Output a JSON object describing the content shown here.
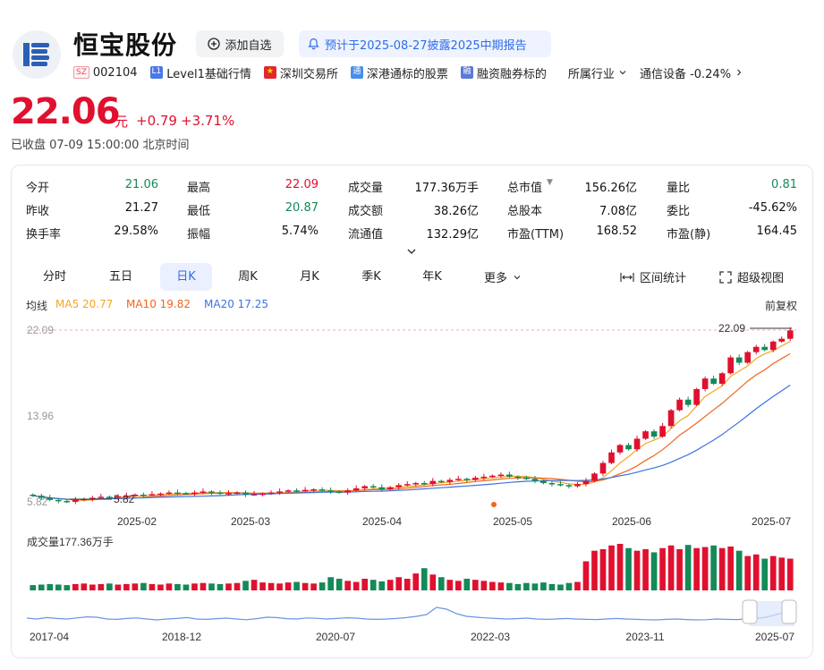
{
  "stock": {
    "name": "恒宝股份",
    "market": "SZ",
    "code": "002104",
    "add_watchlist": "添加自选",
    "notice": "预计于2025-08-27披露2025中期报告",
    "tags": {
      "level1": "Level1基础行情",
      "exchange": "深圳交易所",
      "connect": "深港通标的股票",
      "margin": "融资融券标的",
      "industry_label": "所属行业",
      "industry_value": "通信设备 -0.24%"
    }
  },
  "quote": {
    "price": "22.06",
    "unit": "元",
    "change": "+0.79",
    "change_pct": "+3.71%",
    "status": "已收盘 07-09 15:00:00 北京时间"
  },
  "stats": [
    [
      {
        "label": "今开",
        "value": "21.06"
      },
      {
        "label": "最高",
        "value": "22.09"
      },
      {
        "label": "成交量",
        "value": "177.36万手"
      },
      {
        "label": "总市值",
        "value": "156.26亿"
      },
      {
        "label": "量比",
        "value": "0.81"
      }
    ],
    [
      {
        "label": "昨收",
        "value": "21.27"
      },
      {
        "label": "最低",
        "value": "20.87"
      },
      {
        "label": "成交额",
        "value": "38.26亿"
      },
      {
        "label": "总股本",
        "value": "7.08亿"
      },
      {
        "label": "委比",
        "value": "-45.62%"
      }
    ],
    [
      {
        "label": "换手率",
        "value": "29.58%"
      },
      {
        "label": "振幅",
        "value": "5.74%"
      },
      {
        "label": "流通值",
        "value": "132.29亿"
      },
      {
        "label": "市盈(TTM)",
        "value": "168.52"
      },
      {
        "label": "市盈(静)",
        "value": "164.45"
      }
    ]
  ],
  "tabs": [
    "分时",
    "五日",
    "日K",
    "周K",
    "月K",
    "季K",
    "年K",
    "更多"
  ],
  "active_tab": "日K",
  "tools": {
    "range": "区间统计",
    "full": "超级视图"
  },
  "ma": {
    "label": "均线",
    "ma5": "MA5 20.77",
    "ma10": "MA10 19.82",
    "ma20": "MA20 17.25",
    "adjust": "前复权"
  },
  "colors": {
    "up": "#e0102f",
    "down": "#138a57",
    "ma5": "#f5a623",
    "ma10": "#f0661e",
    "ma20": "#3b73e0",
    "accent": "#2f6de8"
  },
  "chart_data": {
    "type": "candlestick",
    "y_labels": [
      "22.09",
      "13.96",
      "5.82"
    ],
    "ylim": [
      5.82,
      22.09
    ],
    "high_marker": "22.09",
    "low_marker": "5.82",
    "x_labels": [
      "2025-02",
      "2025-03",
      "2025-04",
      "2025-05",
      "2025-06",
      "2025-07"
    ],
    "volume_label": "成交量177.36万手",
    "overview_x_labels": [
      "2017-04",
      "2018-12",
      "2020-07",
      "2022-03",
      "2023-11",
      "2025-07"
    ],
    "closes": [
      6.4,
      6.2,
      6.0,
      5.9,
      5.82,
      6.0,
      6.1,
      6.2,
      6.3,
      6.25,
      6.35,
      6.4,
      6.5,
      6.45,
      6.55,
      6.6,
      6.7,
      6.65,
      6.6,
      6.7,
      6.8,
      6.7,
      6.6,
      6.65,
      6.7,
      6.5,
      6.55,
      6.6,
      6.7,
      6.8,
      6.9,
      6.85,
      6.95,
      7.0,
      6.9,
      6.8,
      6.7,
      6.9,
      7.1,
      7.3,
      7.2,
      7.0,
      7.2,
      7.4,
      7.5,
      7.6,
      7.5,
      7.8,
      7.7,
      7.9,
      8.0,
      7.9,
      8.1,
      8.2,
      8.3,
      8.4,
      8.2,
      8.1,
      8.0,
      7.8,
      7.6,
      7.5,
      7.4,
      7.3,
      7.5,
      7.8,
      8.5,
      9.5,
      10.5,
      11.2,
      10.8,
      11.8,
      12.5,
      12.0,
      13.0,
      14.5,
      15.5,
      15.0,
      16.5,
      17.5,
      17.0,
      18.0,
      19.5,
      19.0,
      20.0,
      20.5,
      20.2,
      21.0,
      21.27,
      22.06
    ],
    "volumes": [
      1.0,
      1.1,
      1.2,
      1.1,
      1.0,
      1.2,
      1.3,
      1.1,
      1.2,
      1.3,
      1.1,
      1.2,
      1.3,
      1.4,
      1.2,
      1.1,
      1.3,
      1.2,
      1.1,
      1.3,
      1.4,
      1.3,
      1.2,
      1.3,
      1.4,
      1.8,
      2.0,
      1.5,
      1.4,
      1.3,
      1.5,
      1.6,
      1.4,
      1.3,
      1.5,
      2.5,
      2.2,
      1.8,
      1.6,
      2.2,
      2.0,
      1.7,
      2.0,
      2.5,
      2.2,
      3.2,
      4.2,
      3.0,
      2.5,
      2.0,
      1.8,
      2.2,
      2.0,
      1.8,
      1.6,
      1.5,
      1.4,
      1.2,
      1.4,
      1.3,
      1.5,
      1.2,
      1.1,
      1.4,
      1.6,
      5.5,
      7.5,
      7.8,
      8.5,
      8.8,
      8.0,
      7.5,
      7.8,
      7.2,
      8.0,
      8.5,
      7.8,
      8.6,
      8.0,
      8.2,
      8.5,
      8.0,
      8.3,
      7.5,
      6.5,
      6.8,
      6.0,
      6.5,
      6.2,
      6.0
    ],
    "overview": [
      0.35,
      0.3,
      0.38,
      0.33,
      0.3,
      0.36,
      0.42,
      0.4,
      0.3,
      0.28,
      0.33,
      0.36,
      0.3,
      0.25,
      0.3,
      0.33,
      0.38,
      0.3,
      0.28,
      0.32,
      0.35,
      0.3,
      0.26,
      0.32,
      0.4,
      0.38,
      0.32,
      0.3,
      0.36,
      0.34,
      0.3,
      0.33,
      0.37,
      0.35,
      0.3,
      0.28,
      0.3,
      0.33,
      0.38,
      0.45,
      0.55,
      0.95,
      0.85,
      0.6,
      0.45,
      0.4,
      0.36,
      0.33,
      0.3,
      0.32,
      0.35,
      0.3,
      0.28,
      0.3,
      0.33,
      0.3,
      0.28,
      0.27,
      0.3,
      0.33,
      0.3,
      0.28,
      0.26,
      0.25,
      0.28,
      0.3,
      0.27,
      0.25,
      0.26,
      0.3,
      0.28,
      0.27,
      0.3,
      0.33,
      0.4,
      0.55,
      0.7,
      0.82
    ]
  }
}
